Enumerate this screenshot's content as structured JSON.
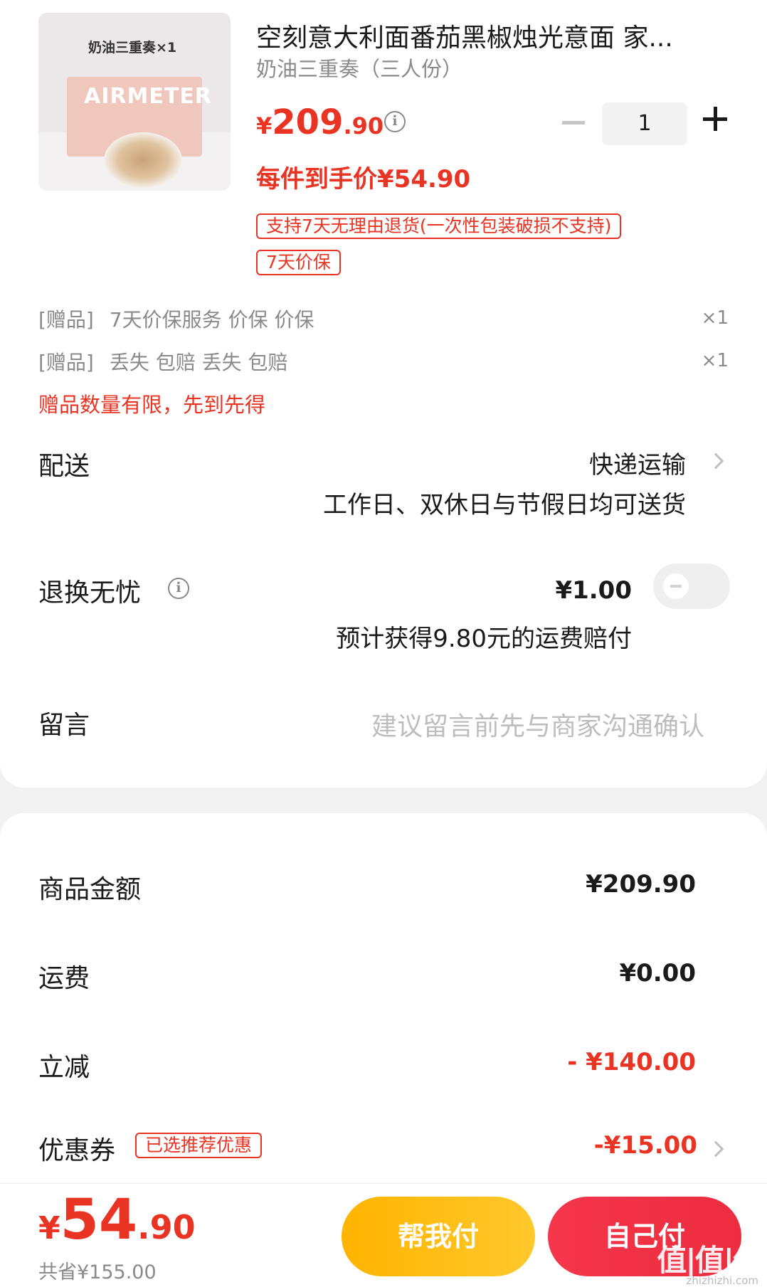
{
  "product": {
    "image_title": "奶油三重奏×1",
    "image_brand": "AIRMETER",
    "title": "空刻意大利面番茄黑椒烛光意面 家...",
    "variant": "奶油三重奏（三人份）",
    "price_currency": "¥",
    "price_int": "209",
    "price_dec": ".90",
    "unit_price": "每件到手价¥54.90",
    "quantity": "1",
    "tags": [
      "支持7天无理由退货(一次性包装破损不支持)",
      "7天价保"
    ]
  },
  "gifts": {
    "items": [
      {
        "tag": "[赠品]",
        "name": "7天价保服务 价保 价保",
        "qty": "×1"
      },
      {
        "tag": "[赠品]",
        "name": "丢失 包赔  丢失 包赔",
        "qty": "×1"
      }
    ],
    "note": "赠品数量有限，先到先得"
  },
  "delivery": {
    "label": "配送",
    "method": "快递运输",
    "schedule": "工作日、双休日与节假日均可送货"
  },
  "return_service": {
    "label": "退换无忧",
    "price": "¥1.00",
    "desc": "预计获得9.80元的运费赔付",
    "enabled": false
  },
  "message": {
    "label": "留言",
    "placeholder": "建议留言前先与商家沟通确认"
  },
  "summary": {
    "goods_label": "商品金额",
    "goods_value": "¥209.90",
    "shipping_label": "运费",
    "shipping_value": "¥0.00",
    "discount_label": "立减",
    "discount_value": "- ¥140.00",
    "coupon_label": "优惠券",
    "coupon_tag": "已选推荐优惠",
    "coupon_value": "-¥15.00"
  },
  "footer": {
    "total_currency": "¥",
    "total_int": "54",
    "total_dec": ".90",
    "saved": "共省¥155.00",
    "help_pay": "帮我付",
    "self_pay": "自己付",
    "watermark": "值|值|值",
    "watermark_url": "zhizhizhi.com"
  },
  "colors": {
    "accent_red": "#e93323",
    "help_button": "#ffb400",
    "pay_button": "#f5364b"
  }
}
